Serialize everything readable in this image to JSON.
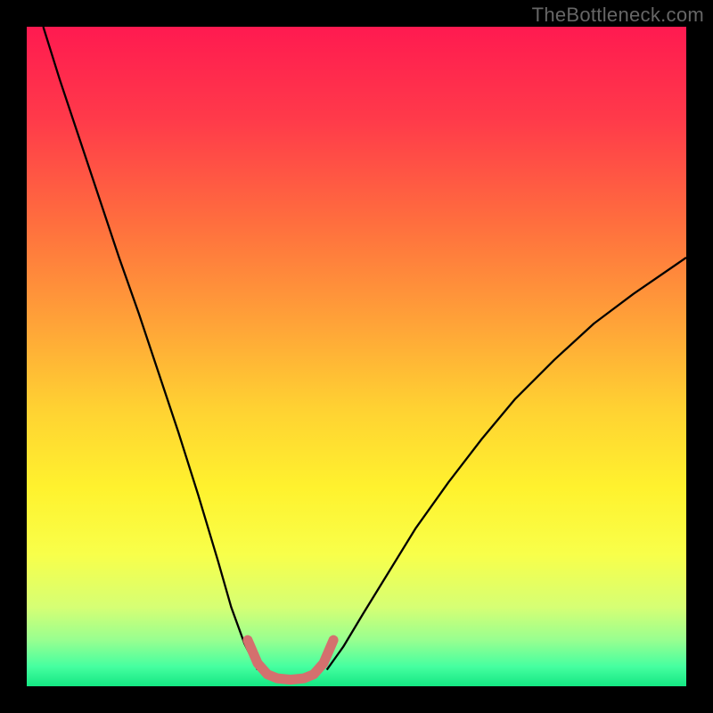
{
  "watermark": "TheBottleneck.com",
  "chart_data": {
    "type": "line",
    "title": "",
    "xlabel": "",
    "ylabel": "",
    "xlim": [
      0,
      100
    ],
    "ylim": [
      0,
      100
    ],
    "background_gradient": {
      "stops": [
        {
          "offset": 0,
          "color": "#ff1a50"
        },
        {
          "offset": 0.14,
          "color": "#ff3a4a"
        },
        {
          "offset": 0.3,
          "color": "#ff6f3e"
        },
        {
          "offset": 0.45,
          "color": "#ffa338"
        },
        {
          "offset": 0.58,
          "color": "#ffd232"
        },
        {
          "offset": 0.7,
          "color": "#fff22e"
        },
        {
          "offset": 0.8,
          "color": "#f8ff4a"
        },
        {
          "offset": 0.88,
          "color": "#d6ff74"
        },
        {
          "offset": 0.93,
          "color": "#98ff90"
        },
        {
          "offset": 0.97,
          "color": "#46ffa0"
        },
        {
          "offset": 1.0,
          "color": "#14e783"
        }
      ]
    },
    "series": [
      {
        "name": "left-branch",
        "stroke": "#000000",
        "width": 2.3,
        "x": [
          2.5,
          5,
          8,
          11,
          14,
          17,
          20,
          23,
          26,
          29,
          31,
          33,
          35
        ],
        "y": [
          100,
          92,
          83,
          74,
          65,
          56.5,
          47.5,
          38.5,
          29,
          19,
          12,
          6.5,
          2.5
        ]
      },
      {
        "name": "right-branch",
        "stroke": "#000000",
        "width": 2.3,
        "x": [
          45.5,
          48,
          51,
          55,
          59,
          64,
          69,
          74,
          80,
          86,
          92,
          100
        ],
        "y": [
          2.5,
          6,
          11,
          17.5,
          24,
          31,
          37.5,
          43.5,
          49.5,
          55,
          59.5,
          65
        ]
      },
      {
        "name": "valley-highlight",
        "stroke": "#d4706e",
        "width": 11,
        "linecap": "round",
        "x": [
          33.5,
          35,
          36.5,
          38,
          40,
          42,
          43.5,
          45,
          46.5
        ],
        "y": [
          7,
          3.5,
          1.8,
          1.2,
          1.0,
          1.2,
          1.8,
          3.5,
          7
        ]
      }
    ]
  }
}
